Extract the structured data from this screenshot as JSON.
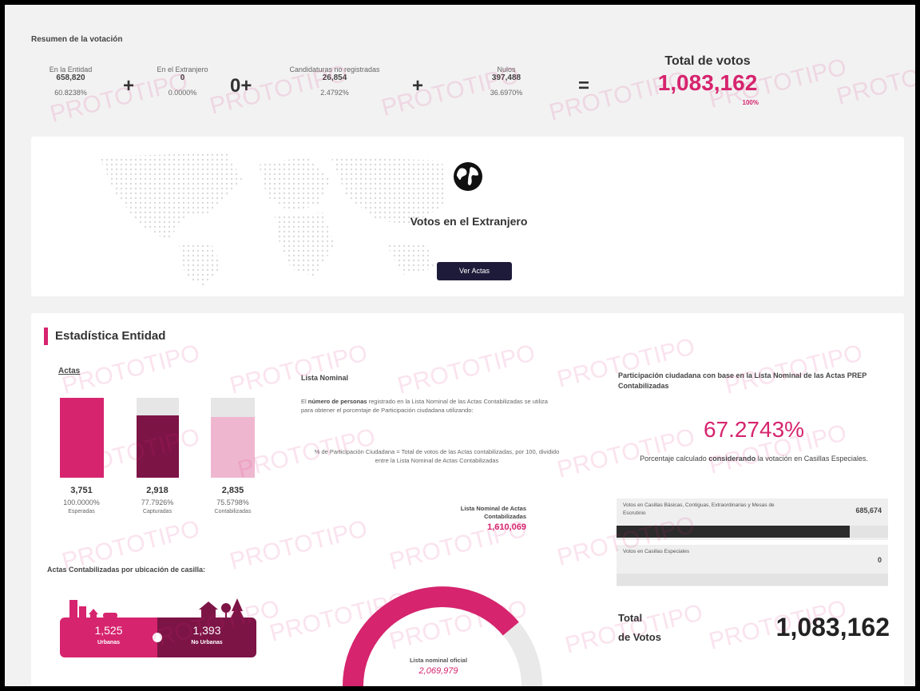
{
  "summary": {
    "title": "Resumen de la votación",
    "items": [
      {
        "label": "En la Entidad",
        "value": "658,820",
        "pct": "60.8238%"
      },
      {
        "label": "En el Extranjero",
        "value": "0",
        "pct": "0.0000%"
      },
      {
        "label": "Candidaturas no registradas",
        "value": "26,854",
        "pct": "2.4792%"
      },
      {
        "label": "Nulos",
        "value": "397,488",
        "pct": "36.6970%"
      }
    ],
    "operators": [
      "+",
      "0+",
      "+",
      "="
    ],
    "total_label": "Total de votos",
    "total_value": "1,083,162",
    "total_pct": "100%"
  },
  "abroad": {
    "title": "Votos en el Extranjero",
    "button": "Ver Actas",
    "icon": "globe-icon"
  },
  "stats": {
    "title": "Estadística Entidad",
    "actas": {
      "title": "Actas",
      "bars": [
        {
          "value": "3,751",
          "pct": "100.0000%",
          "label": "Esperadas",
          "fill": 1.0,
          "color": "#d6246e"
        },
        {
          "value": "2,918",
          "pct": "77.7926%",
          "label": "Capturadas",
          "fill": 0.778,
          "color": "#7d1446"
        },
        {
          "value": "2,835",
          "pct": "75.5798%",
          "label": "Contabilizadas",
          "fill": 0.756,
          "color": "#efb6cf"
        }
      ]
    },
    "lista": {
      "title": "Lista Nominal",
      "desc_bold": "número de personas",
      "desc_pre": "El",
      "desc_post": "registrado en la Lista Nominal de las Actas Contabilizadas se utiliza para obtener el porcentaje de Participación ciudadana utilizando:",
      "formula": "% de Participación Ciudadana = Total de votos de las Actas contabilizadas, por 100, dividido entre la Lista Nominal de Actas Contabilizadas",
      "contab_label": "Lista Nominal de Actas Contabilizadas",
      "contab_value": "1,610,069",
      "oficial_label": "Lista nominal oficial",
      "oficial_value": "2,069,979",
      "gauge_fraction": 0.778
    },
    "ubicacion": {
      "title": "Actas Contabilizadas por ubicación de casilla:",
      "urbanas_value": "1,525",
      "urbanas_label": "Urbanas",
      "no_urbanas_value": "1,393",
      "no_urbanas_label": "No Urbanas"
    },
    "participacion": {
      "title": "Participación ciudadana con base en la Lista Nominal de las Actas PREP Contabilizadas",
      "value": "67.2743%",
      "note_pre": "Porcentaje calculado",
      "note_bold": "considerando",
      "note_post": "la votación en Casillas Especiales.",
      "rows": [
        {
          "label": "Votos en Casillas Básicas, Contiguas, Extraordinarias y Mesas de Escrutinio",
          "value": "685,674",
          "fill": 0.86
        },
        {
          "label": "Votos en Casillas Especiales",
          "value": "0",
          "fill": 0.0
        }
      ],
      "total_label_1": "Total",
      "total_label_2": "de Votos",
      "total_value": "1,083,162"
    }
  },
  "watermark": "PROTOTIPO",
  "colors": {
    "accent": "#d6246e",
    "dark": "#7d1446",
    "light": "#efb6cf",
    "button": "#1e1b3a"
  }
}
